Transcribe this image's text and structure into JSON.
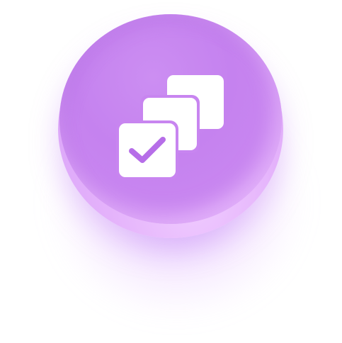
{
  "icon": {
    "name": "stacked-checkbox-icon",
    "colors": {
      "face": "#c885f0",
      "rim": "#e9bdfb",
      "glyph": "#ffffff",
      "check": "#b66ee8"
    }
  }
}
